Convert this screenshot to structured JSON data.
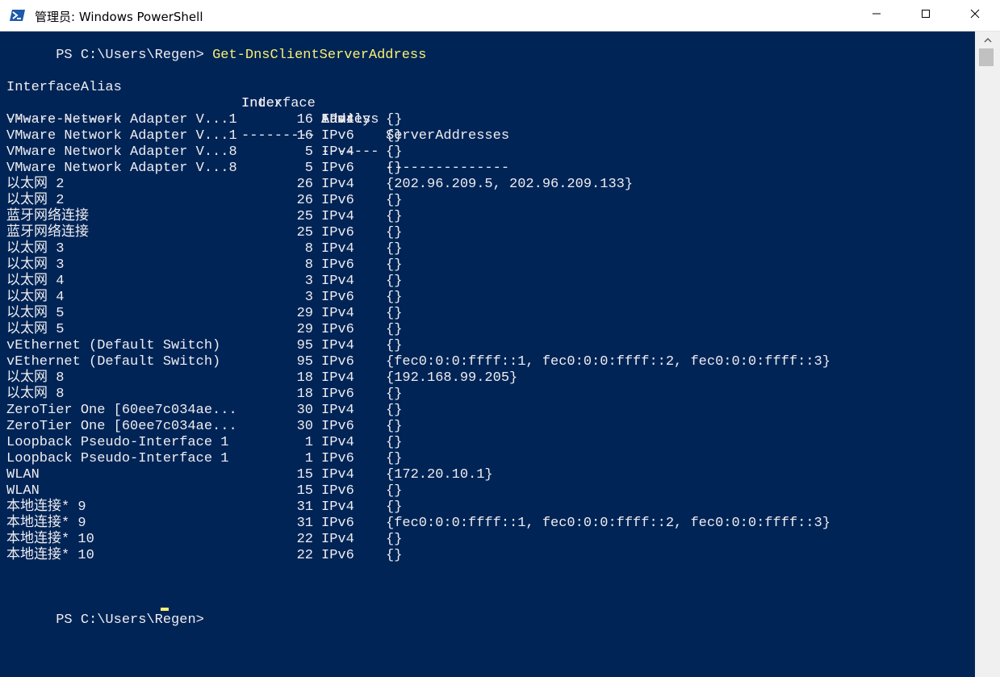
{
  "window": {
    "title": "管理员: Windows PowerShell",
    "minimize_label": "Minimize",
    "maximize_label": "Maximize",
    "close_label": "Close"
  },
  "console": {
    "prompt1": "PS C:\\Users\\Regen> ",
    "command1": "Get-DnsClientServerAddress",
    "headers": {
      "alias": "InterfaceAlias",
      "index_line1": "Interface",
      "index_line2": "Index",
      "family_line1": "Address",
      "family_line2": "Family",
      "servers": "ServerAddresses"
    },
    "separators": {
      "alias": "--------------",
      "index": "---------",
      "family": "-------",
      "servers": "---------------"
    },
    "rows": [
      {
        "alias": "VMware Network Adapter V...1",
        "index": "16",
        "family": "IPv4",
        "servers": "{}"
      },
      {
        "alias": "VMware Network Adapter V...1",
        "index": "16",
        "family": "IPv6",
        "servers": "{}"
      },
      {
        "alias": "VMware Network Adapter V...8",
        "index": "5",
        "family": "IPv4",
        "servers": "{}"
      },
      {
        "alias": "VMware Network Adapter V...8",
        "index": "5",
        "family": "IPv6",
        "servers": "{}"
      },
      {
        "alias": "以太网 2",
        "index": "26",
        "family": "IPv4",
        "servers": "{202.96.209.5, 202.96.209.133}"
      },
      {
        "alias": "以太网 2",
        "index": "26",
        "family": "IPv6",
        "servers": "{}"
      },
      {
        "alias": "蓝牙网络连接",
        "index": "25",
        "family": "IPv4",
        "servers": "{}"
      },
      {
        "alias": "蓝牙网络连接",
        "index": "25",
        "family": "IPv6",
        "servers": "{}"
      },
      {
        "alias": "以太网 3",
        "index": "8",
        "family": "IPv4",
        "servers": "{}"
      },
      {
        "alias": "以太网 3",
        "index": "8",
        "family": "IPv6",
        "servers": "{}"
      },
      {
        "alias": "以太网 4",
        "index": "3",
        "family": "IPv4",
        "servers": "{}"
      },
      {
        "alias": "以太网 4",
        "index": "3",
        "family": "IPv6",
        "servers": "{}"
      },
      {
        "alias": "以太网 5",
        "index": "29",
        "family": "IPv4",
        "servers": "{}"
      },
      {
        "alias": "以太网 5",
        "index": "29",
        "family": "IPv6",
        "servers": "{}"
      },
      {
        "alias": "vEthernet (Default Switch)",
        "index": "95",
        "family": "IPv4",
        "servers": "{}"
      },
      {
        "alias": "vEthernet (Default Switch)",
        "index": "95",
        "family": "IPv6",
        "servers": "{fec0:0:0:ffff::1, fec0:0:0:ffff::2, fec0:0:0:ffff::3}"
      },
      {
        "alias": "以太网 8",
        "index": "18",
        "family": "IPv4",
        "servers": "{192.168.99.205}"
      },
      {
        "alias": "以太网 8",
        "index": "18",
        "family": "IPv6",
        "servers": "{}"
      },
      {
        "alias": "ZeroTier One [60ee7c034ae...",
        "index": "30",
        "family": "IPv4",
        "servers": "{}"
      },
      {
        "alias": "ZeroTier One [60ee7c034ae...",
        "index": "30",
        "family": "IPv6",
        "servers": "{}"
      },
      {
        "alias": "Loopback Pseudo-Interface 1",
        "index": "1",
        "family": "IPv4",
        "servers": "{}"
      },
      {
        "alias": "Loopback Pseudo-Interface 1",
        "index": "1",
        "family": "IPv6",
        "servers": "{}"
      },
      {
        "alias": "WLAN",
        "index": "15",
        "family": "IPv4",
        "servers": "{172.20.10.1}"
      },
      {
        "alias": "WLAN",
        "index": "15",
        "family": "IPv6",
        "servers": "{}"
      },
      {
        "alias": "本地连接* 9",
        "index": "31",
        "family": "IPv4",
        "servers": "{}"
      },
      {
        "alias": "本地连接* 9",
        "index": "31",
        "family": "IPv6",
        "servers": "{fec0:0:0:ffff::1, fec0:0:0:ffff::2, fec0:0:0:ffff::3}"
      },
      {
        "alias": "本地连接* 10",
        "index": "22",
        "family": "IPv4",
        "servers": "{}"
      },
      {
        "alias": "本地连接* 10",
        "index": "22",
        "family": "IPv6",
        "servers": "{}"
      }
    ],
    "prompt2": "PS C:\\Users\\Regen> "
  },
  "colors": {
    "console_bg": "#012456",
    "console_text": "#eeedf0",
    "command_text": "#f8f074",
    "titlebar_bg": "#ffffff",
    "scrollbar_bg": "#f0f0f0"
  },
  "icons": {
    "app": "powershell-icon",
    "minimize": "minimize-icon",
    "maximize": "maximize-icon",
    "close": "close-icon",
    "scroll_up": "scroll-up-arrow-icon"
  }
}
